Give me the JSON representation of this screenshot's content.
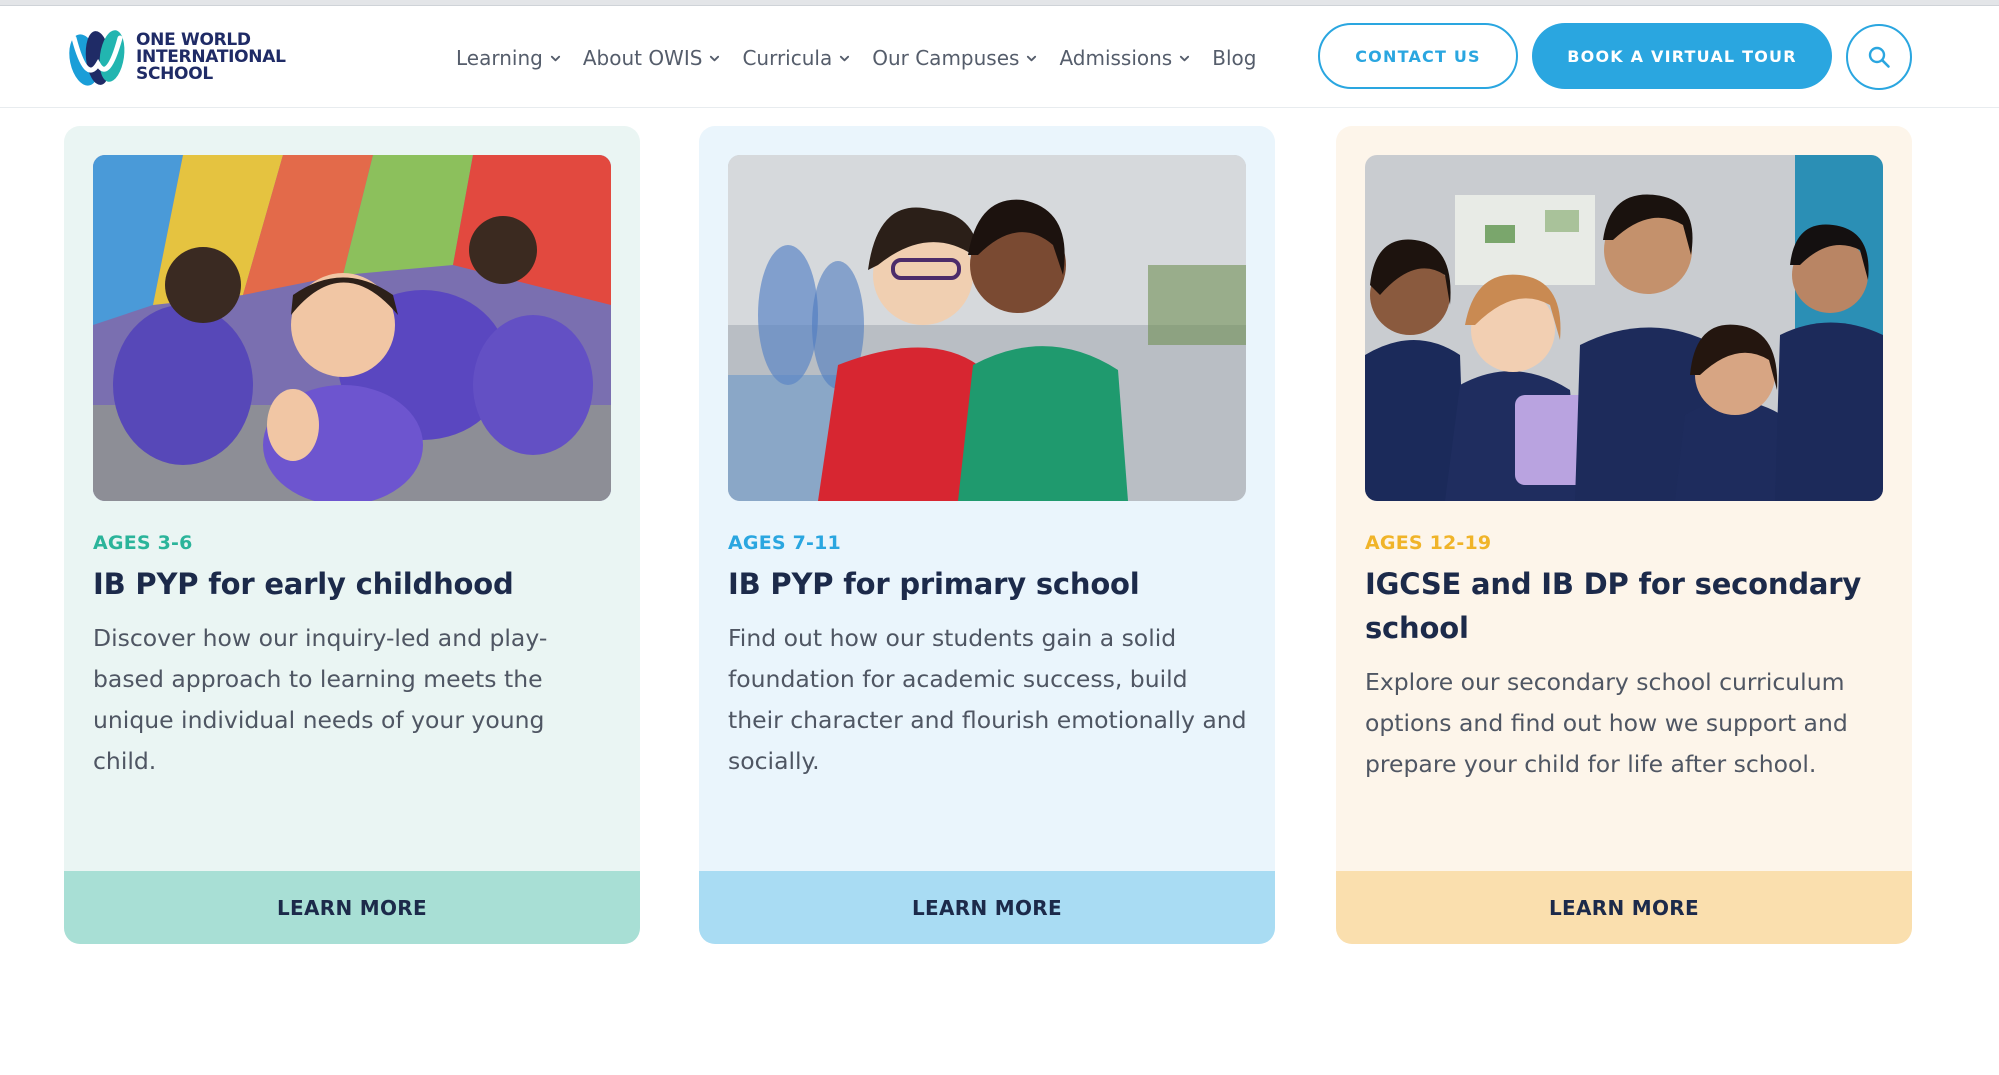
{
  "header": {
    "logo": {
      "line1": "ONE WORLD",
      "line2": "INTERNATIONAL",
      "line3": "SCHOOL"
    },
    "nav": [
      {
        "label": "Learning",
        "has_dropdown": true
      },
      {
        "label": "About OWIS",
        "has_dropdown": true
      },
      {
        "label": "Curricula",
        "has_dropdown": true
      },
      {
        "label": "Our Campuses",
        "has_dropdown": true
      },
      {
        "label": "Admissions",
        "has_dropdown": true
      },
      {
        "label": "Blog",
        "has_dropdown": false
      }
    ],
    "contact_label": "CONTACT US",
    "tour_label": "BOOK A VIRTUAL TOUR",
    "search_icon": "search-icon"
  },
  "cards": [
    {
      "age": "AGES 3-6",
      "title": "IB PYP for early childhood",
      "description": "Discover how our inquiry-led and play-based approach to learning meets the unique individual needs of your young child.",
      "button": "LEARN MORE"
    },
    {
      "age": "AGES 7-11",
      "title": "IB PYP for primary school",
      "description": "Find out how our students gain a solid foundation for academic success, build their character and flourish emotionally and socially.",
      "button": "LEARN MORE"
    },
    {
      "age": "AGES 12-19",
      "title": "IGCSE and IB DP for secondary school",
      "description": "Explore our secondary school curriculum options and find out how we support and prepare your child for life after school.",
      "button": "LEARN MORE"
    }
  ],
  "colors": {
    "brand_blue": "#2aa6e0",
    "navy": "#1c2a4a",
    "teal": "#2bb49a",
    "amber": "#f0b429"
  }
}
